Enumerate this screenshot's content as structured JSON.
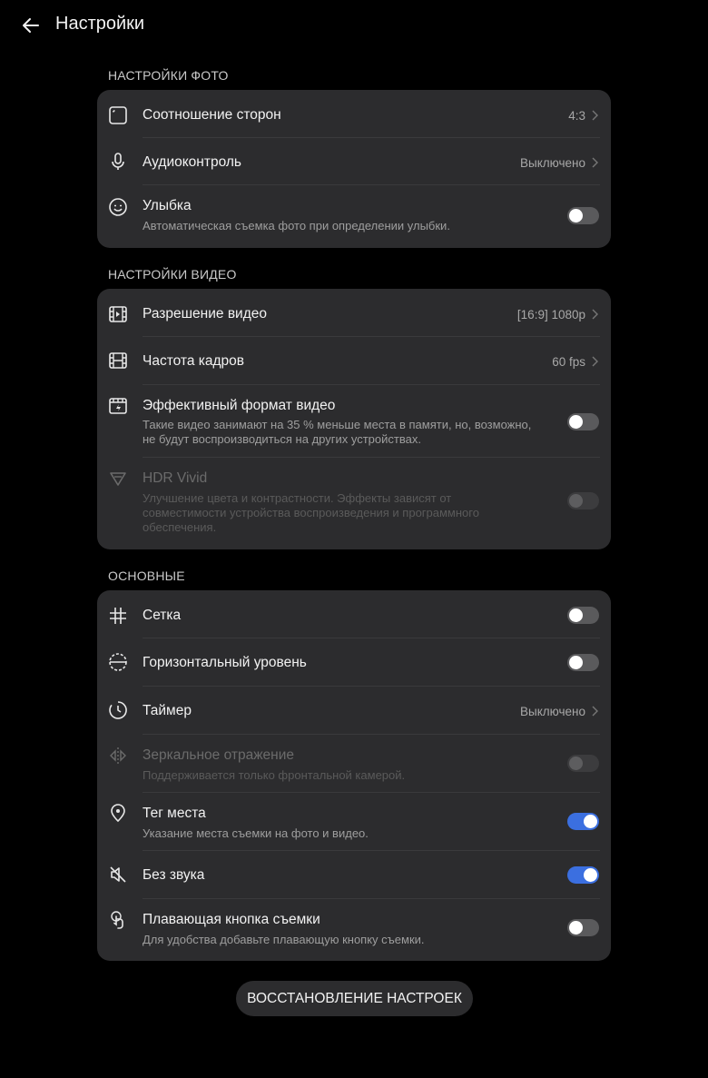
{
  "header": {
    "title": "Настройки",
    "back_icon": "arrow-left-icon"
  },
  "photo": {
    "section_title": "НАСТРОЙКИ ФОТО",
    "aspect": {
      "label": "Соотношение сторон",
      "value": "4:3",
      "icon": "aspect-ratio-icon"
    },
    "audio": {
      "label": "Аудиоконтроль",
      "value": "Выключено",
      "icon": "microphone-icon"
    },
    "smile": {
      "label": "Улыбка",
      "desc": "Автоматическая съемка фото при определении улыбки.",
      "icon": "smile-icon",
      "enabled": false
    }
  },
  "video": {
    "section_title": "НАСТРОЙКИ ВИДЕО",
    "resolution": {
      "label": "Разрешение видео",
      "value": "[16:9] 1080p",
      "icon": "video-resolution-icon"
    },
    "fps": {
      "label": "Частота кадров",
      "value": "60 fps",
      "icon": "film-icon"
    },
    "efficient": {
      "label": "Эффективный формат видео",
      "desc": "Такие видео занимают на 35 % меньше места в памяти, но, возможно, не будут воспроизводиться на других устройствах.",
      "icon": "efficient-video-icon",
      "enabled": false
    },
    "hdr": {
      "label": "HDR Vivid",
      "desc": "Улучшение цвета и контрастности. Эффекты зависят от совместимости устройства воспроизведения и программного обеспечения.",
      "icon": "hdr-icon",
      "enabled": false,
      "disabled": true
    }
  },
  "general": {
    "section_title": "ОСНОВНЫЕ",
    "grid": {
      "label": "Сетка",
      "icon": "grid-icon",
      "enabled": false
    },
    "level": {
      "label": "Горизонтальный уровень",
      "icon": "level-icon",
      "enabled": false
    },
    "timer": {
      "label": "Таймер",
      "value": "Выключено",
      "icon": "timer-icon"
    },
    "mirror": {
      "label": "Зеркальное отражение",
      "desc": "Поддерживается только фронтальной камерой.",
      "icon": "mirror-icon",
      "enabled": false,
      "disabled": true
    },
    "geotag": {
      "label": "Тег места",
      "desc": "Указание места съемки на фото и видео.",
      "icon": "location-icon",
      "enabled": true
    },
    "mute": {
      "label": "Без звука",
      "icon": "mute-icon",
      "enabled": true
    },
    "floating": {
      "label": "Плавающая кнопка съемки",
      "desc": "Для удобства добавьте плавающую кнопку съемки.",
      "icon": "floating-shutter-icon",
      "enabled": false
    }
  },
  "reset_label": "ВОССТАНОВЛЕНИЕ НАСТРОЕК",
  "colors": {
    "background": "#000000",
    "card": "#2c2c2e",
    "accent": "#3b6fe0"
  }
}
